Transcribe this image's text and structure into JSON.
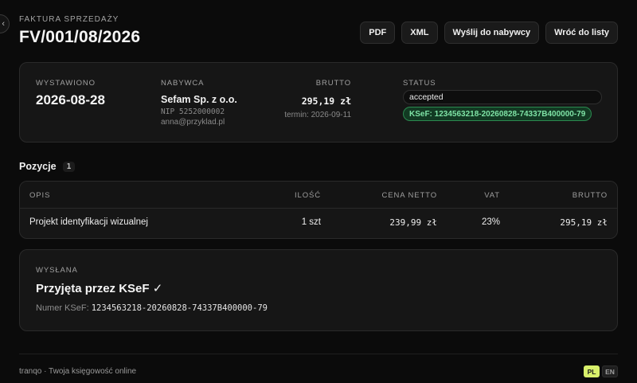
{
  "header": {
    "eyebrow": "FAKTURA SPRZEDAŻY",
    "title": "FV/001/08/2026",
    "actions": {
      "pdf": "PDF",
      "xml": "XML",
      "send": "Wyślij do nabywcy",
      "back": "Wróć do listy"
    }
  },
  "summary": {
    "issued_label": "WYSTAWIONO",
    "issued_value": "2026-08-28",
    "buyer_label": "NABYWCA",
    "buyer_name": "Sefam Sp. z o.o.",
    "buyer_nip": "NIP 5252000002",
    "buyer_email": "anna@przyklad.pl",
    "brutto_label": "BRUTTO",
    "brutto_value": "295,19 zł",
    "due": "termin: 2026-09-11",
    "status_label": "STATUS",
    "status_value": "accepted",
    "ksef_badge": "KSeF: 1234563218-20260828-74337B400000-79"
  },
  "items": {
    "title": "Pozycje",
    "count": "1",
    "columns": [
      "OPIS",
      "ILOŚĆ",
      "CENA NETTO",
      "VAT",
      "BRUTTO"
    ],
    "rows": [
      [
        "Projekt identyfikacji wizualnej",
        "1 szt",
        "239,99 zł",
        "23%",
        "295,19 zł"
      ]
    ]
  },
  "sent": {
    "label": "WYSŁANA",
    "title": "Przyjęta przez KSeF ✓",
    "ksef_prefix": "Numer KSeF:",
    "ksef_number": "1234563218-20260828-74337B400000-79"
  },
  "footer": {
    "text": "tranqo · Twoja księgowość online",
    "lang_pl": "PL",
    "lang_en": "EN"
  },
  "colors": {
    "background": "#0b0b0b",
    "card": "#161616",
    "ksef_green": "#7fe3a6",
    "lang_active": "#d8f06b"
  }
}
